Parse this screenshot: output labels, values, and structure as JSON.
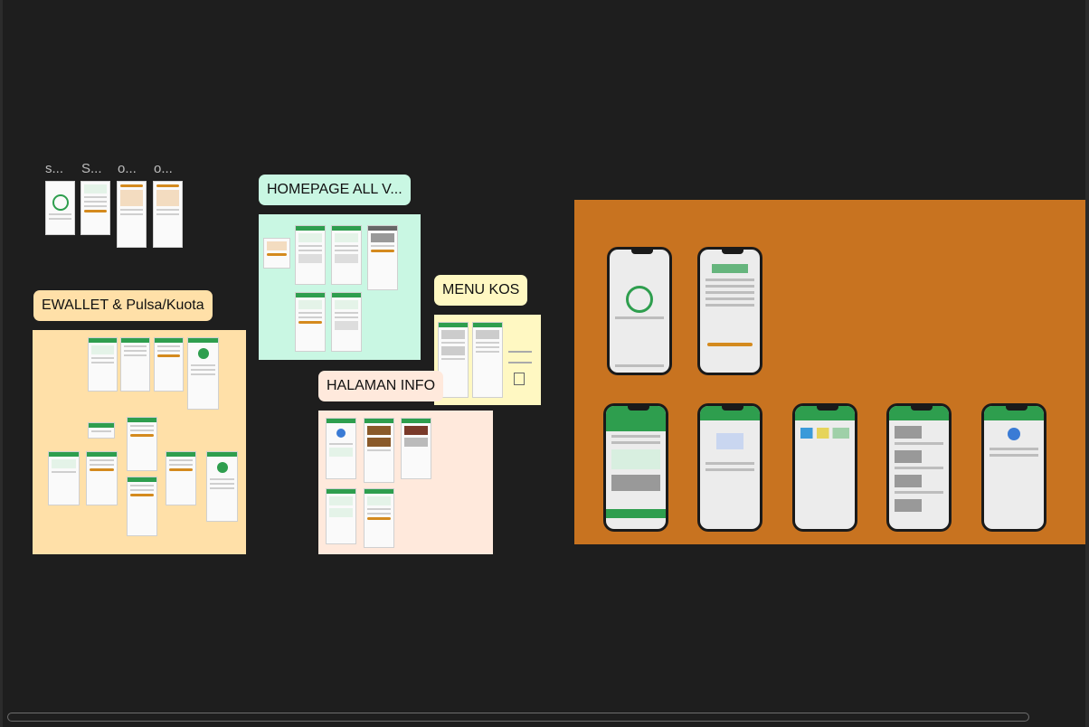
{
  "canvas": {
    "frame_titles": [
      "s...",
      "S...",
      "o...",
      "o..."
    ],
    "sections": {
      "ewallet": {
        "label": "EWALLET & Pulsa/Kuota",
        "color": "#ffe0a8"
      },
      "homepage": {
        "label": "HOMEPAGE ALL V...",
        "color": "#c9f7e3"
      },
      "menu_kos": {
        "label": "MENU KOS",
        "color": "#fff8c2"
      },
      "halaman_info": {
        "label": "HALAMAN INFO",
        "color": "#ffe9dc"
      },
      "orange": {
        "color": "#c87320"
      }
    },
    "accent_green": "#2e9e4e",
    "accent_orange": "#d48a1e"
  }
}
